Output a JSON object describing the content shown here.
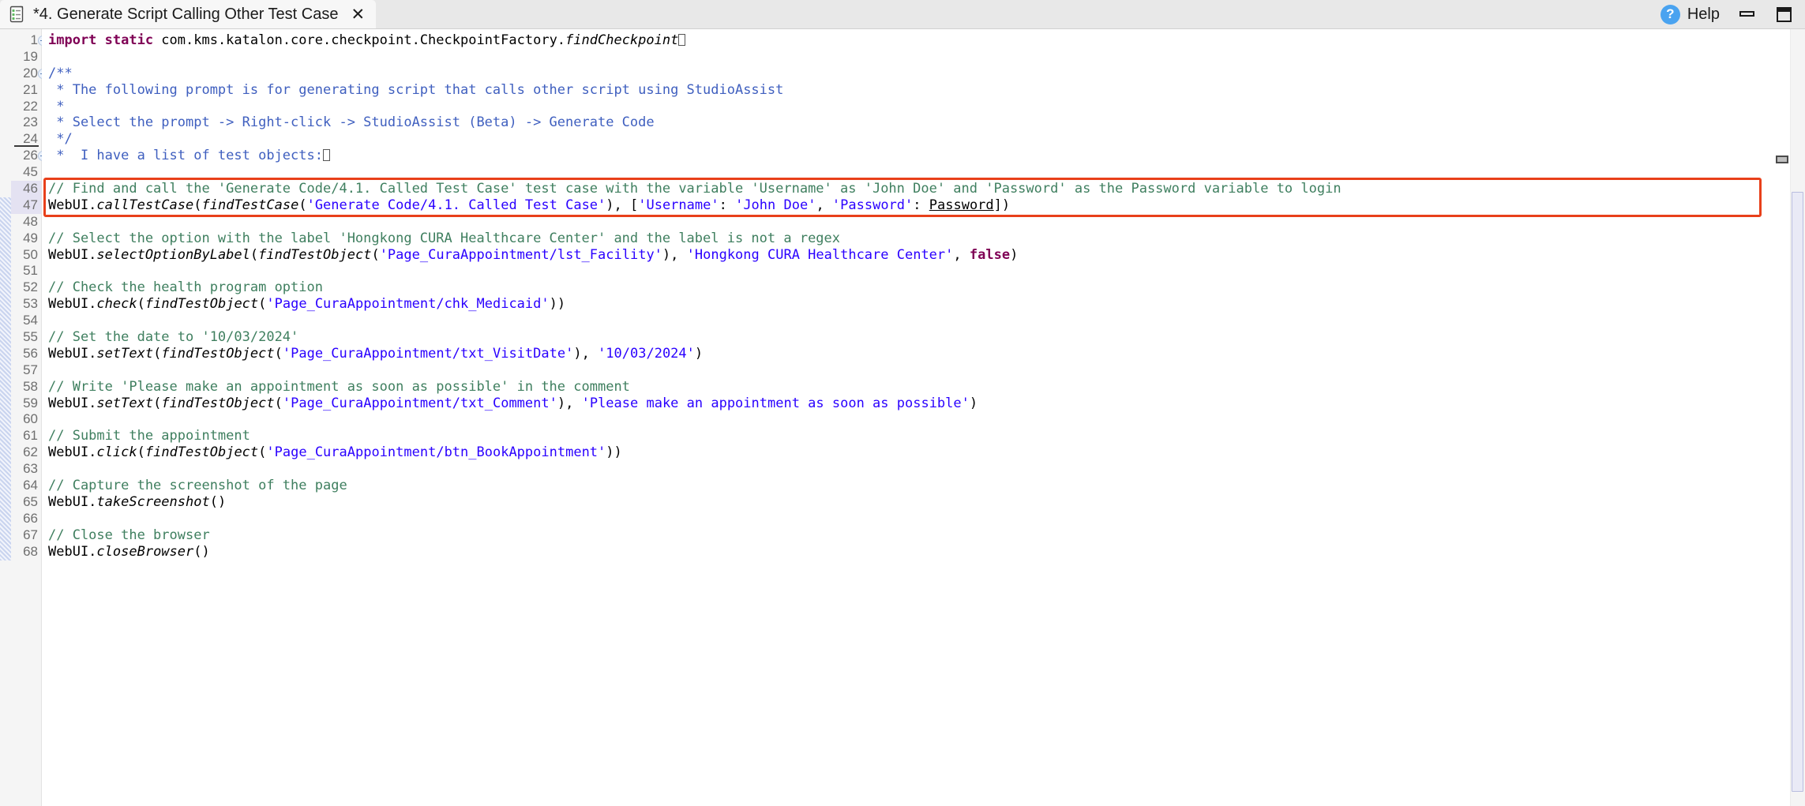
{
  "window": {
    "tab_title": "*4. Generate Script Calling Other Test Case",
    "tab_close_glyph": "✕",
    "help_label": "Help",
    "help_badge_glyph": "?",
    "minimize_name": "minimize-button",
    "restore_name": "restore-button"
  },
  "colors": {
    "callout_border": "#e8401a",
    "keyword": "#7f0055",
    "string": "#2a00ff",
    "block_comment": "#3f5fbf",
    "line_comment": "#3f7f5f",
    "help_badge": "#4aa3f0"
  },
  "editor": {
    "line_numbers": [
      "1",
      "19",
      "20",
      "21",
      "22",
      "23",
      "24",
      "26",
      "45",
      "46",
      "47",
      "48",
      "49",
      "50",
      "51",
      "52",
      "53",
      "54",
      "55",
      "56",
      "57",
      "58",
      "59",
      "60",
      "61",
      "62",
      "63",
      "64",
      "65",
      "66",
      "67",
      "68"
    ],
    "lines": [
      {
        "num": "1",
        "fold": "plus",
        "segments": [
          {
            "t": "import static ",
            "c": "kw"
          },
          {
            "t": "com.kms.katalon.core.checkpoint.CheckpointFactory.",
            "c": "plain"
          },
          {
            "t": "findCheckpoint",
            "c": "ital"
          },
          {
            "t": "⎕",
            "c": "caret"
          }
        ]
      },
      {
        "num": "19",
        "segments": []
      },
      {
        "num": "20",
        "fold": "minus",
        "segments": [
          {
            "t": "/**",
            "c": "cmtblk"
          }
        ]
      },
      {
        "num": "21",
        "segments": [
          {
            "t": " * The following prompt is for generating script that calls other script using StudioAssist",
            "c": "cmtblk"
          }
        ]
      },
      {
        "num": "22",
        "segments": [
          {
            "t": " *",
            "c": "cmtblk"
          }
        ]
      },
      {
        "num": "23",
        "segments": [
          {
            "t": " * Select the prompt -> Right-click -> StudioAssist (Beta) -> Generate Code",
            "c": "cmtblk"
          }
        ]
      },
      {
        "num": "24",
        "underline": true,
        "segments": [
          {
            "t": " */",
            "c": "cmtblk"
          }
        ]
      },
      {
        "num": "26",
        "fold": "plus",
        "segments": [
          {
            "t": " *  I have a list of test objects:",
            "c": "cmtblk"
          },
          {
            "t": "⎕",
            "c": "caret"
          }
        ]
      },
      {
        "num": "45",
        "segments": []
      },
      {
        "num": "46",
        "highlight": true,
        "segments": [
          {
            "t": "// Find and call the 'Generate Code/4.1. Called Test Case' test case with the variable 'Username' as 'John Doe' and 'Password' as the Password variable to login",
            "c": "cmtline"
          }
        ]
      },
      {
        "num": "47",
        "highlight": true,
        "marker": "caret",
        "segments": [
          {
            "t": "WebUI.",
            "c": "plain"
          },
          {
            "t": "callTestCase",
            "c": "ital"
          },
          {
            "t": "(",
            "c": "plain"
          },
          {
            "t": "findTestCase",
            "c": "ital"
          },
          {
            "t": "(",
            "c": "plain"
          },
          {
            "t": "'Generate Code/4.1. Called Test Case'",
            "c": "str"
          },
          {
            "t": "), [",
            "c": "plain"
          },
          {
            "t": "'Username'",
            "c": "str"
          },
          {
            "t": ": ",
            "c": "plain"
          },
          {
            "t": "'John Doe'",
            "c": "str"
          },
          {
            "t": ", ",
            "c": "plain"
          },
          {
            "t": "'Password'",
            "c": "str"
          },
          {
            "t": ": ",
            "c": "plain"
          },
          {
            "t": "Password",
            "c": "undl"
          },
          {
            "t": "])",
            "c": "plain"
          }
        ]
      },
      {
        "num": "48",
        "segments": []
      },
      {
        "num": "49",
        "segments": [
          {
            "t": "// Select the option with the label 'Hongkong CURA Healthcare Center' and the label is not a regex",
            "c": "cmtline"
          }
        ]
      },
      {
        "num": "50",
        "segments": [
          {
            "t": "WebUI.",
            "c": "plain"
          },
          {
            "t": "selectOptionByLabel",
            "c": "ital"
          },
          {
            "t": "(",
            "c": "plain"
          },
          {
            "t": "findTestObject",
            "c": "ital"
          },
          {
            "t": "(",
            "c": "plain"
          },
          {
            "t": "'Page_CuraAppointment/lst_Facility'",
            "c": "str"
          },
          {
            "t": "), ",
            "c": "plain"
          },
          {
            "t": "'Hongkong CURA Healthcare Center'",
            "c": "str"
          },
          {
            "t": ", ",
            "c": "plain"
          },
          {
            "t": "false",
            "c": "kw"
          },
          {
            "t": ")",
            "c": "plain"
          }
        ]
      },
      {
        "num": "51",
        "segments": []
      },
      {
        "num": "52",
        "segments": [
          {
            "t": "// Check the health program option",
            "c": "cmtline"
          }
        ]
      },
      {
        "num": "53",
        "segments": [
          {
            "t": "WebUI.",
            "c": "plain"
          },
          {
            "t": "check",
            "c": "ital"
          },
          {
            "t": "(",
            "c": "plain"
          },
          {
            "t": "findTestObject",
            "c": "ital"
          },
          {
            "t": "(",
            "c": "plain"
          },
          {
            "t": "'Page_CuraAppointment/chk_Medicaid'",
            "c": "str"
          },
          {
            "t": "))",
            "c": "plain"
          }
        ]
      },
      {
        "num": "54",
        "segments": []
      },
      {
        "num": "55",
        "segments": [
          {
            "t": "// Set the date to '10/03/2024'",
            "c": "cmtline"
          }
        ]
      },
      {
        "num": "56",
        "segments": [
          {
            "t": "WebUI.",
            "c": "plain"
          },
          {
            "t": "setText",
            "c": "ital"
          },
          {
            "t": "(",
            "c": "plain"
          },
          {
            "t": "findTestObject",
            "c": "ital"
          },
          {
            "t": "(",
            "c": "plain"
          },
          {
            "t": "'Page_CuraAppointment/txt_VisitDate'",
            "c": "str"
          },
          {
            "t": "), ",
            "c": "plain"
          },
          {
            "t": "'10/03/2024'",
            "c": "str"
          },
          {
            "t": ")",
            "c": "plain"
          }
        ]
      },
      {
        "num": "57",
        "segments": []
      },
      {
        "num": "58",
        "segments": [
          {
            "t": "// Write 'Please make an appointment as soon as possible' in the comment",
            "c": "cmtline"
          }
        ]
      },
      {
        "num": "59",
        "segments": [
          {
            "t": "WebUI.",
            "c": "plain"
          },
          {
            "t": "setText",
            "c": "ital"
          },
          {
            "t": "(",
            "c": "plain"
          },
          {
            "t": "findTestObject",
            "c": "ital"
          },
          {
            "t": "(",
            "c": "plain"
          },
          {
            "t": "'Page_CuraAppointment/txt_Comment'",
            "c": "str"
          },
          {
            "t": "), ",
            "c": "plain"
          },
          {
            "t": "'Please make an appointment as soon as possible'",
            "c": "str"
          },
          {
            "t": ")",
            "c": "plain"
          }
        ]
      },
      {
        "num": "60",
        "segments": []
      },
      {
        "num": "61",
        "segments": [
          {
            "t": "// Submit the appointment",
            "c": "cmtline"
          }
        ]
      },
      {
        "num": "62",
        "segments": [
          {
            "t": "WebUI.",
            "c": "plain"
          },
          {
            "t": "click",
            "c": "ital"
          },
          {
            "t": "(",
            "c": "plain"
          },
          {
            "t": "findTestObject",
            "c": "ital"
          },
          {
            "t": "(",
            "c": "plain"
          },
          {
            "t": "'Page_CuraAppointment/btn_BookAppointment'",
            "c": "str"
          },
          {
            "t": "))",
            "c": "plain"
          }
        ]
      },
      {
        "num": "63",
        "segments": []
      },
      {
        "num": "64",
        "segments": [
          {
            "t": "// Capture the screenshot of the page",
            "c": "cmtline"
          }
        ]
      },
      {
        "num": "65",
        "segments": [
          {
            "t": "WebUI.",
            "c": "plain"
          },
          {
            "t": "takeScreenshot",
            "c": "ital"
          },
          {
            "t": "()",
            "c": "plain"
          }
        ]
      },
      {
        "num": "66",
        "segments": []
      },
      {
        "num": "67",
        "segments": [
          {
            "t": "// Close the browser",
            "c": "cmtline"
          }
        ]
      },
      {
        "num": "68",
        "segments": [
          {
            "t": "WebUI.",
            "c": "plain"
          },
          {
            "t": "closeBrowser",
            "c": "ital"
          },
          {
            "t": "()",
            "c": "plain"
          }
        ]
      }
    ]
  }
}
